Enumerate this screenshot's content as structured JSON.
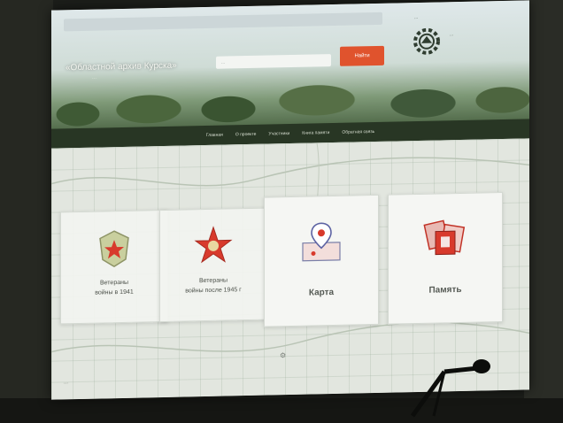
{
  "header": {
    "site_title": "«Областной архив Курска»",
    "site_subtitle": "...",
    "search_placeholder": "...",
    "search_button": "Найти",
    "partner_top": "...",
    "partner_text": "..."
  },
  "nav": {
    "items": [
      "Главная",
      "О проекте",
      "Участники",
      "Книга памяти",
      "Обратная связь"
    ]
  },
  "tiles": [
    {
      "label_lines": [
        "Ветераны",
        "войны в 1941"
      ],
      "icon": "medal-badge-icon"
    },
    {
      "label_lines": [
        "Ветераны",
        "войны после 1945 г"
      ],
      "icon": "red-star-icon"
    },
    {
      "label_lines": [
        "Карта"
      ],
      "icon": "map-pin-icon"
    },
    {
      "label_lines": [
        "Память"
      ],
      "icon": "memory-photos-icon"
    }
  ],
  "footer": {
    "link_text": "..."
  },
  "colors": {
    "accent": "#e0532d",
    "nav": "#283624",
    "star": "#d83a2c"
  }
}
